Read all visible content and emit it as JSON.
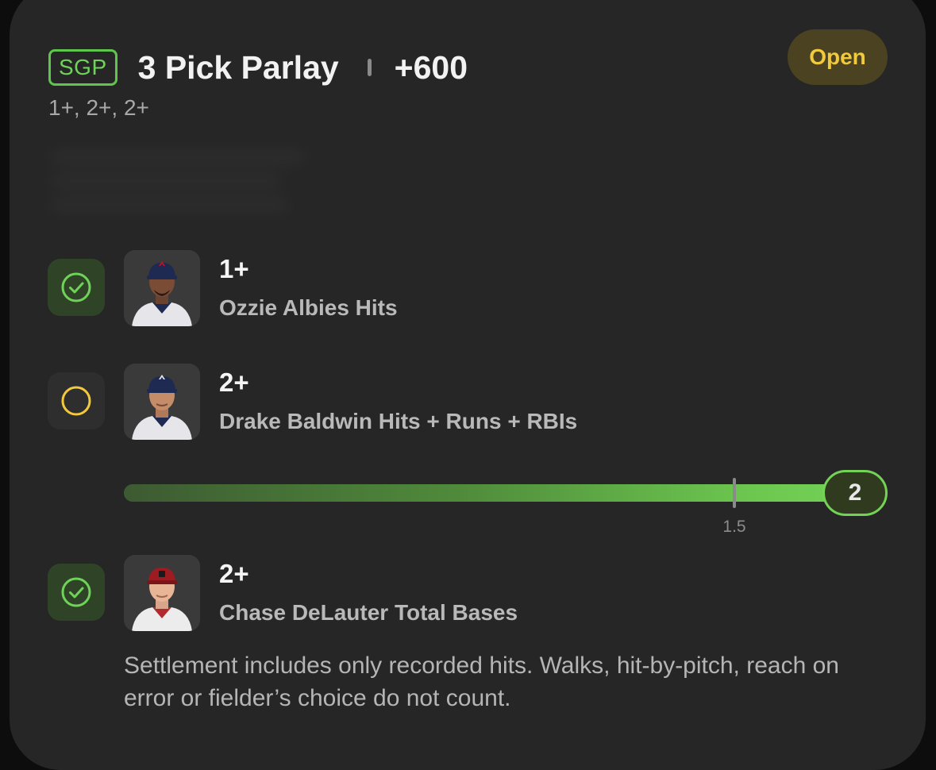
{
  "colors": {
    "card_background": "#262626",
    "accent_green": "#6fd35a",
    "open_yellow": "#f1c93d",
    "open_pill_background": "#4a4220"
  },
  "bet": {
    "badge": "SGP",
    "title": "3 Pick Parlay",
    "odds": "+600",
    "lines_summary": "1+, 2+, 2+",
    "status": "Open"
  },
  "legs": [
    {
      "line": "1+",
      "market": "Ozzie Albies Hits",
      "status": "won",
      "status_icon": "check-circle-icon",
      "photo": "player-photo-ozzie-albies"
    },
    {
      "line": "2+",
      "market": "Drake Baldwin Hits + Runs + RBIs",
      "status": "open",
      "status_icon": "empty-circle-icon",
      "photo": "player-photo-drake-baldwin",
      "progress": {
        "current": "2",
        "current_value": 2,
        "threshold": "1.5",
        "threshold_value": 1.5,
        "scale_max": 2
      }
    },
    {
      "line": "2+",
      "market": "Chase DeLauter Total Bases",
      "status": "won",
      "status_icon": "check-circle-icon",
      "photo": "player-photo-chase-delauter"
    }
  ],
  "disclaimer": "Settlement includes only recorded hits. Walks, hit-by-pitch, reach on error or fielder’s choice do not count."
}
